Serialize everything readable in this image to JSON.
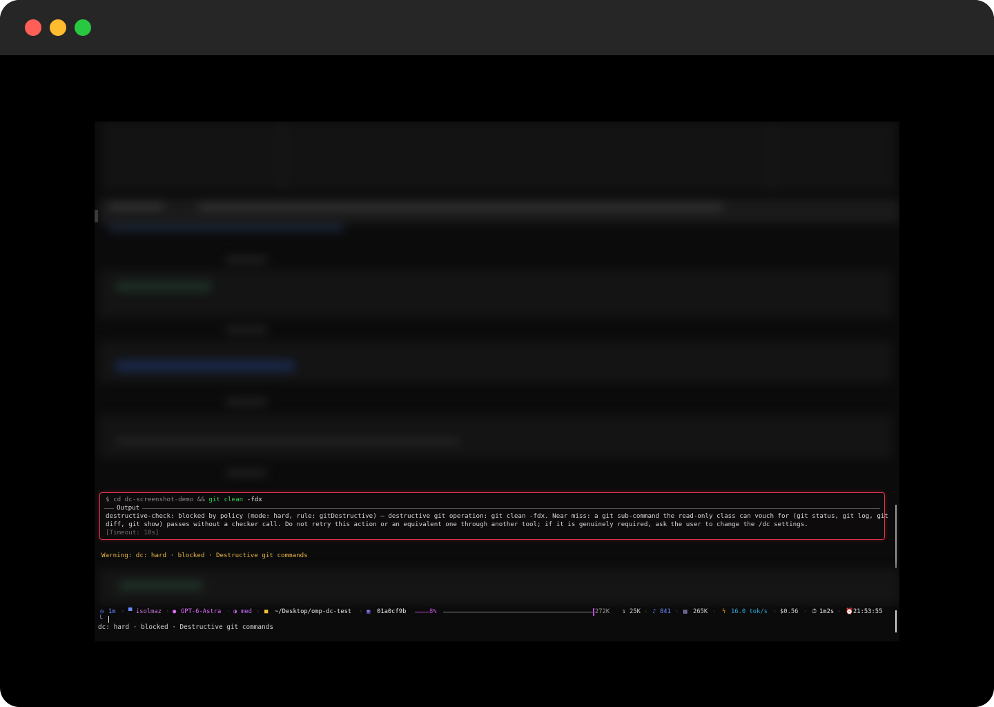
{
  "window": {
    "controls": {
      "close_color": "#ff5f57",
      "minimize_color": "#febc2e",
      "zoom_color": "#28c840"
    }
  },
  "tool_call": {
    "command_prefix": "$ cd dc-screenshot-demo && ",
    "command_git": "git clean",
    "command_flag": " -fdx",
    "output_label": "Output",
    "message_line_1": "destructive-check: blocked by policy (mode: hard, rule: gitDestructive) — destructive git operation: git clean -fdx. Near miss: a git sub-command the read-only class can vouch for (git status, git log, git",
    "message_line_2": "diff, git show) passes without a checker call. Do not retry this action or an equivalent one through another tool; if it is genuinely required, ask the user to change the /dc settings.",
    "timeout": "[Timeout: 10s]",
    "border_color": "#e0354d"
  },
  "warning": {
    "text": "Warning: dc: hard · blocked · Destructive git commands"
  },
  "status_bar": {
    "session": "1m",
    "user": "isolmaz",
    "model": "GPT-6-Astra",
    "effort": "med",
    "path": "~/Desktop/omp-dc-test",
    "commit": "01a0cf9b",
    "context_percent": "8%",
    "context_fraction": 0.08,
    "context_tokens": "272K",
    "input_tokens": "25K",
    "output_tokens": "841",
    "cache_tokens": "265K",
    "speed": "16.0 tok/s",
    "cost": "$0.56",
    "elapsed": "1m2s",
    "clock": "21:53:55",
    "colors": {
      "user": "#c678dd",
      "model": "#e06cff",
      "effort": "#d070ff",
      "path": "#e8e8e8",
      "commit": "#e8e8e8",
      "tokens": "#cfcfcf",
      "speed": "#2fa9d9"
    },
    "icons": {
      "session": "clock-icon",
      "user": "monitor-icon",
      "model": "dot-icon",
      "effort": "gauge-icon",
      "path": "folder-icon",
      "commit": "commit-icon",
      "input": "arrow-in-icon",
      "output": "arrow-out-icon",
      "cache": "save-icon",
      "speed": "bolt-icon",
      "elapsed": "stopwatch-icon",
      "clock": "alarm-icon"
    }
  },
  "footer": {
    "text": "dc: hard · blocked · Destructive git commands"
  }
}
